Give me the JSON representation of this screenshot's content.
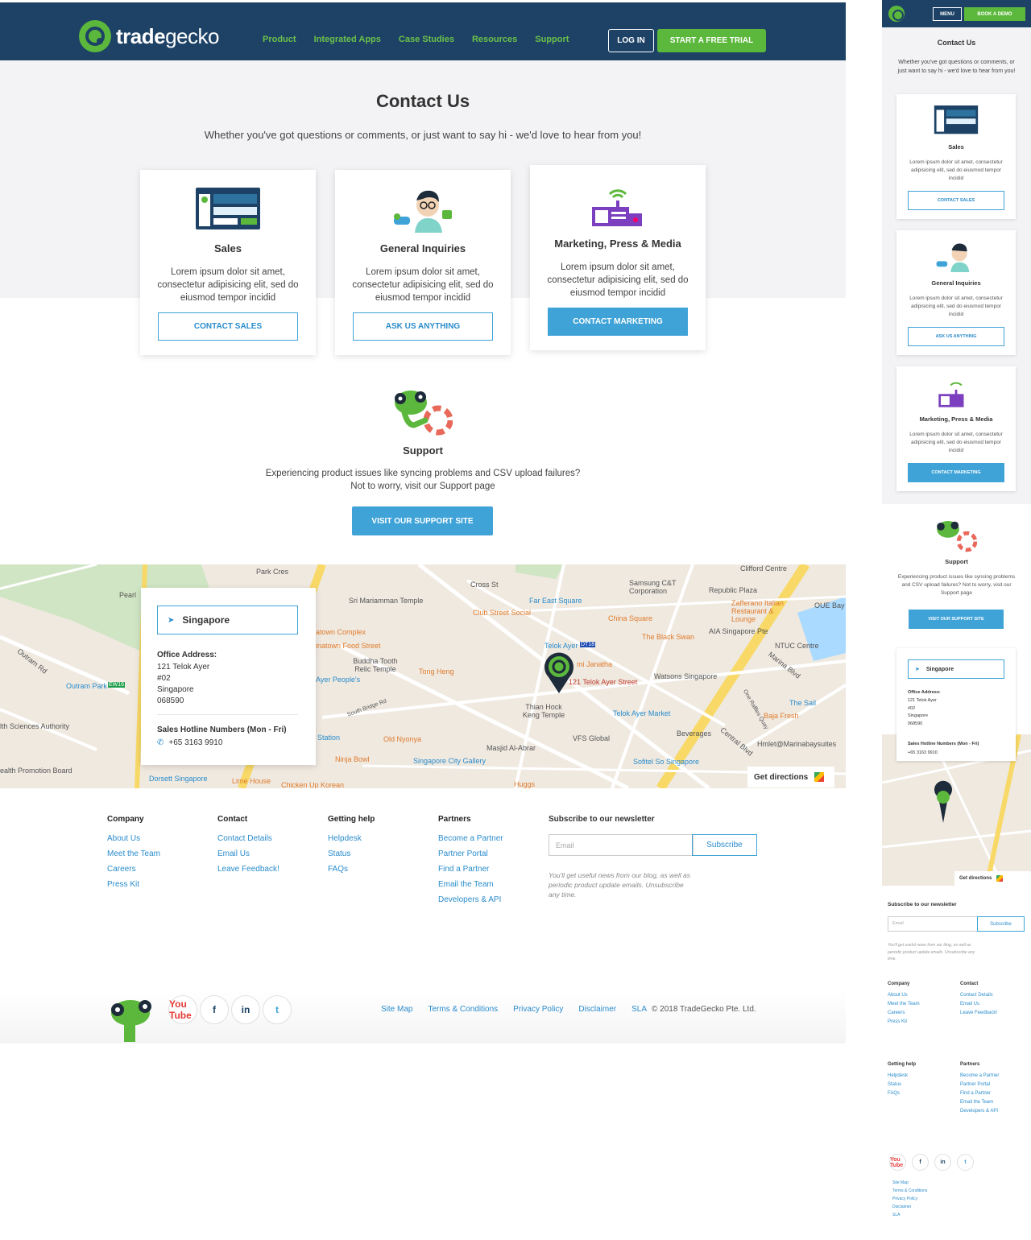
{
  "brand": {
    "name_bold": "trade",
    "name_light": "gecko",
    "accent": "#5cb83c",
    "navy": "#1d4266",
    "blue": "#3fa3d8"
  },
  "nav": {
    "items": [
      "Product",
      "Integrated Apps",
      "Case Studies",
      "Resources",
      "Support"
    ],
    "login": "LOG IN",
    "trial": "START A FREE TRIAL"
  },
  "hero": {
    "title": "Contact Us",
    "subtitle": "Whether you've got questions or comments, or just want to say hi - we'd love to hear from you!"
  },
  "cards": [
    {
      "title": "Sales",
      "text": "Lorem ipsum dolor sit amet, consectetur adipisicing elit, sed do eiusmod tempor incidid",
      "button": "CONTACT SALES"
    },
    {
      "title": "General Inquiries",
      "text": "Lorem ipsum dolor sit amet, consectetur adipisicing elit, sed do eiusmod tempor incidid",
      "button": "ASK US ANYTHING"
    },
    {
      "title": "Marketing, Press & Media",
      "text": "Lorem ipsum dolor sit amet, consectetur adipisicing elit, sed do eiusmod tempor incidid",
      "button": "CONTACT MARKETING"
    }
  ],
  "support": {
    "title": "Support",
    "line1": "Experiencing product issues like syncing problems and CSV upload failures?",
    "line2": "Not to worry, visit our Support page",
    "button": "VISIT OUR SUPPORT SITE"
  },
  "office": {
    "city": "Singapore",
    "address_label": "Office Address:",
    "address_lines": [
      "121 Telok Ayer",
      "#02",
      "Singapore",
      "068590"
    ],
    "hotline_label": "Sales Hotline Numbers (Mon - Fri)",
    "phone": "+65 3163 9910"
  },
  "map": {
    "get_directions": "Get directions",
    "labels": [
      "Pearl",
      "Park Cres",
      "Sri Mariamman Temple",
      "Cross St",
      "Far East Square",
      "Samsung C&T Corporation",
      "Republic Plaza",
      "Clifford Centre",
      "Zafferano Italian Restaurant & Lounge",
      "OUE Bay",
      "Club Street Social",
      "China Square",
      "The Black Swan",
      "AIA Singapore Pte",
      "NTUC Centre",
      "atown Complex",
      "inatown Food Street",
      "Buddha Tooth Relic Temple",
      "Tong Heng",
      "Telok Ayer",
      "DT18",
      "mi Janatha",
      "121 Telok Ayer Street",
      "Watsons Singapore",
      "Marina Blvd",
      "Outram Rd",
      "Outram Park",
      "EW16",
      "Ayer People's",
      "Thian Hock Keng Temple",
      "Telok Ayer Market",
      "The Sail",
      "Baja Fresh",
      "South Bridge Rd",
      "lth Sciences Authority",
      "Station",
      "Old Nyonya",
      "Masjid Al-Abrar",
      "VFS Global",
      "Beverages",
      "Central Blvd",
      "Hmlet@Marinabaysuites",
      "Ninja Bowl",
      "Singapore City Gallery",
      "Sofitel So Singapore",
      "ealth Promotion Board",
      "Dorsett Singapore",
      "Lime House",
      "Chicken Up Korean",
      "Huggs",
      "One Raffles Quay"
    ]
  },
  "footer": {
    "columns": [
      {
        "title": "Company",
        "links": [
          "About Us",
          "Meet the Team",
          "Careers",
          "Press Kit"
        ]
      },
      {
        "title": "Contact",
        "links": [
          "Contact Details",
          "Email Us",
          "Leave Feedback!"
        ]
      },
      {
        "title": "Getting help",
        "links": [
          "Helpdesk",
          "Status",
          "FAQs"
        ]
      },
      {
        "title": "Partners",
        "links": [
          "Become a Partner",
          "Partner Portal",
          "Find a Partner",
          "Email the Team",
          "Developers & API"
        ]
      }
    ],
    "newsletter": {
      "title": "Subscribe to our newsletter",
      "placeholder": "Email",
      "button": "Subscribe",
      "note": "You'll get useful news from our blog, as well as periodic product update emails. Unsubscribe any time."
    },
    "social": [
      "You Tube",
      "f",
      "in",
      "t"
    ],
    "legal": [
      "Site Map",
      "Terms & Conditions",
      "Privacy Policy",
      "Disclaimer",
      "SLA"
    ],
    "copyright": "© 2018 TradeGecko Pte. Ltd."
  },
  "mobile": {
    "menu": "MENU",
    "demo": "BOOK A DEMO",
    "subtitle": "Whether you've got questions or comments, or just want to say hi - we'd love to hear from you!",
    "support_text": "Experiencing product issues like syncing problems and CSV upload failures? Not to worry, visit our Support page"
  }
}
